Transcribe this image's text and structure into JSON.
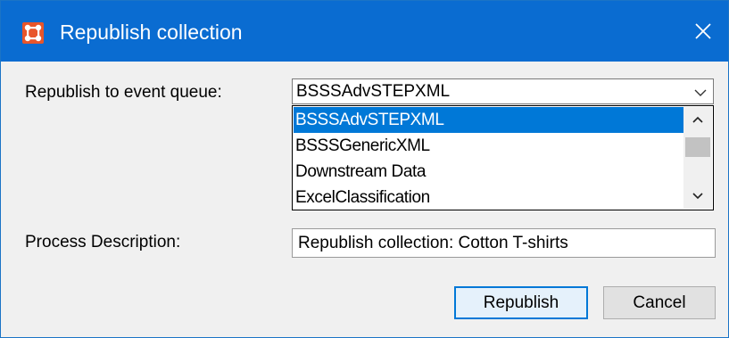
{
  "window": {
    "title": "Republish collection",
    "icon": "app-grid-icon",
    "close_icon": "close-icon",
    "accent_color": "#0a6cd1"
  },
  "form": {
    "queue_label": "Republish to event queue:",
    "queue_selected": "BSSSAdvSTEPXML",
    "queue_options": [
      "BSSSAdvSTEPXML",
      "BSSSGenericXML",
      "Downstream Data",
      "ExcelClassification"
    ],
    "queue_highlighted_index": 0,
    "description_label": "Process Description:",
    "description_value": "Republish collection: Cotton T-shirts"
  },
  "buttons": {
    "republish_label": "Republish",
    "cancel_label": "Cancel"
  }
}
